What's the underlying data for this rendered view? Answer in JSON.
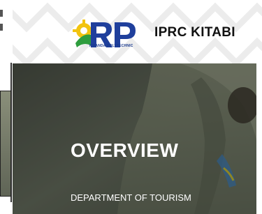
{
  "site": {
    "name": "IPRC KITABI",
    "logo_text": "RP",
    "logo_tagline": "RWANDA POLYTECHNIC"
  },
  "hero": {
    "title": "OVERVIEW",
    "subtitle": "DEPARTMENT OF TOURISM"
  },
  "colors": {
    "logo_blue": "#1f3f9c",
    "logo_yellow": "#f2c40f",
    "logo_green": "#2e9d3e",
    "hero_overlay": "#3f4339"
  }
}
